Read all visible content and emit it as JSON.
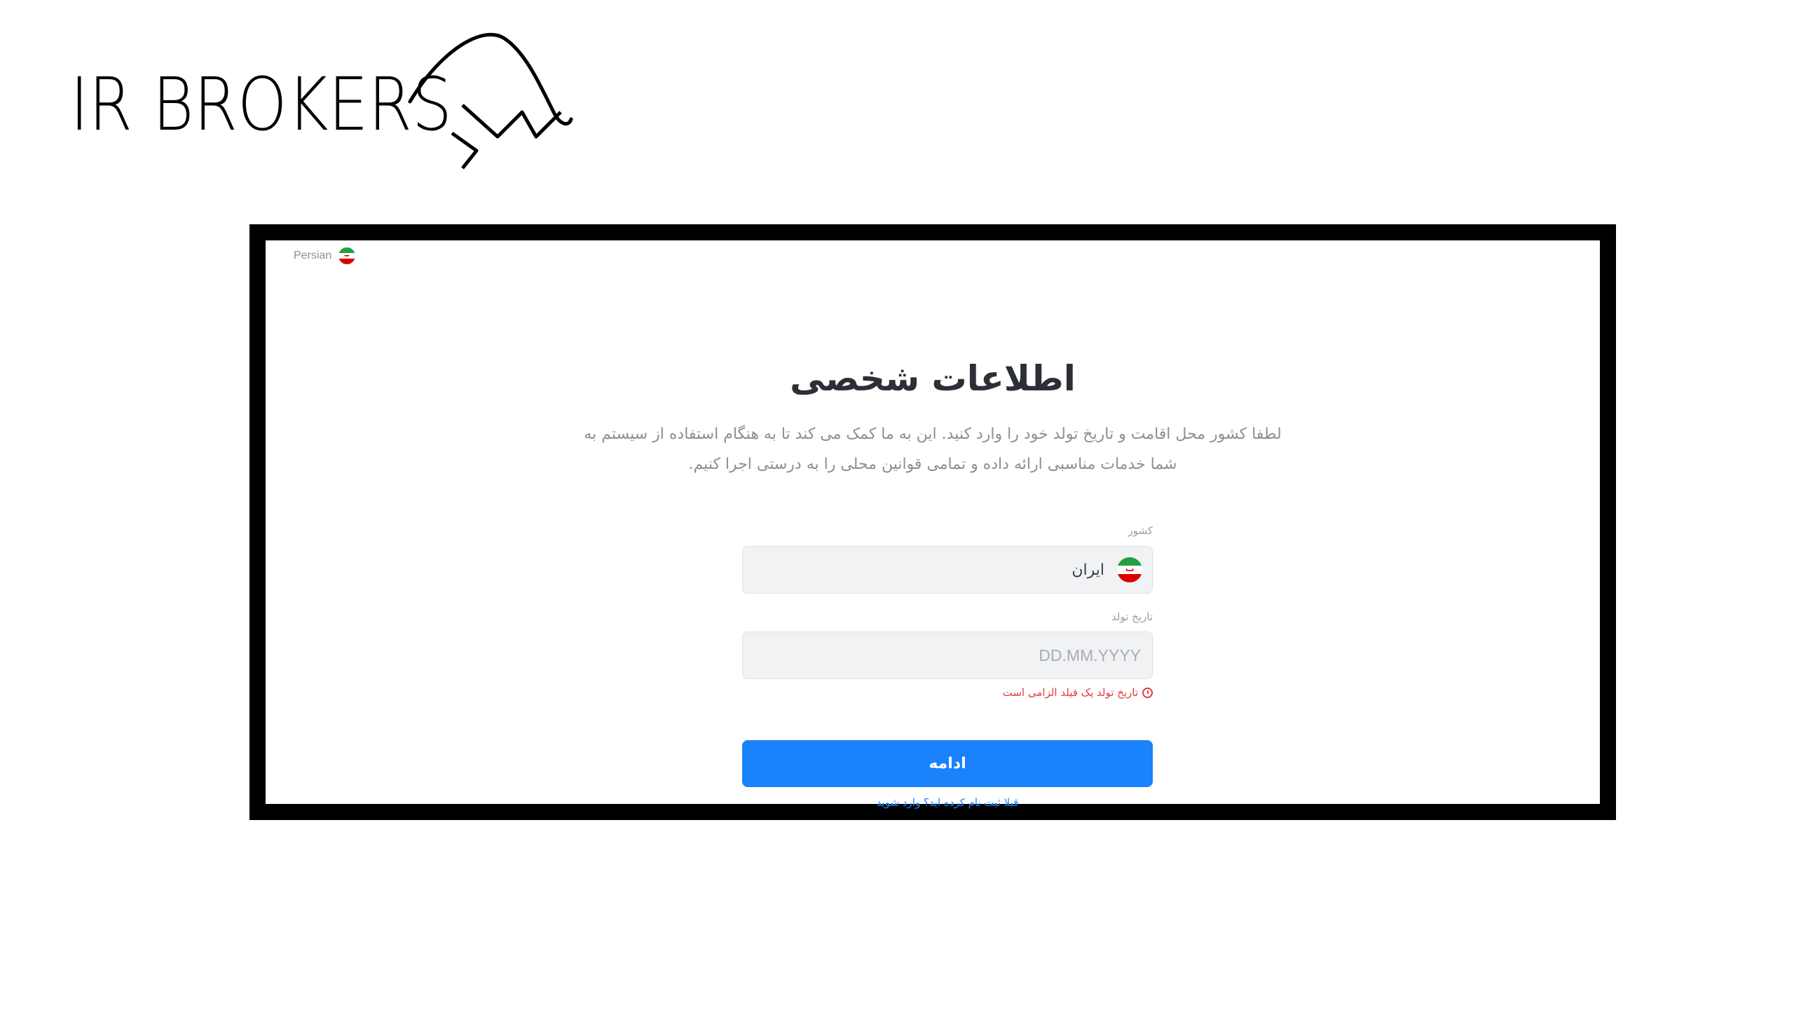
{
  "brand": {
    "logo_text": "IR BROKERS"
  },
  "language": {
    "label": "Persian",
    "icon": "iran-flag-icon"
  },
  "page": {
    "title": "اطلاعات شخصی",
    "description_line1": "لطفا کشور محل اقامت و تاریخ تولد خود را وارد کنید. این به ما کمک می کند تا به هنگام استفاده از سیستم به",
    "description_line2": "شما خدمات مناسبی ارائه داده و تمامی قوانین محلی را به درستی اجرا کنیم."
  },
  "form": {
    "country_label": "کشور",
    "country_value": "ایران",
    "country_icon": "iran-flag-icon",
    "birthdate_label": "تاریخ تولد",
    "birthdate_placeholder": "DD.MM.YYYY",
    "birthdate_value": "",
    "birthdate_error": "تاریخ تولد یک فیلد الزامی است",
    "continue_label": "ادامه",
    "login_link": "قبلا ثبت نام کرده اید؟ وارد شوید"
  },
  "colors": {
    "primary": "#1a82fb",
    "error": "#e5393f",
    "text_dark": "#2c2f36",
    "text_muted": "#8a8f98",
    "frame": "#000000"
  }
}
